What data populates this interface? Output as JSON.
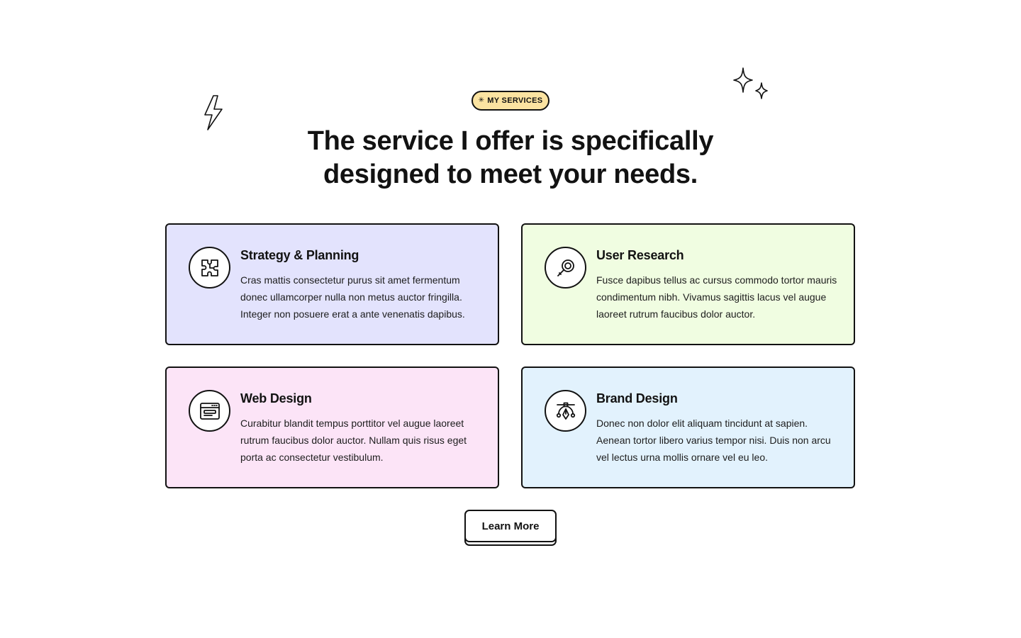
{
  "badge": {
    "icon": "asterisk-icon",
    "label": "MY SERVICES",
    "color": "#fbe3a1"
  },
  "heading": {
    "line1": "The service I offer is specifically",
    "line2": "designed to meet your needs."
  },
  "services": [
    {
      "icon": "puzzle-icon",
      "title": "Strategy & Planning",
      "description": "Cras mattis consectetur purus sit amet fermentum donec ullamcorper nulla non metus auctor fringilla. Integer non posuere erat a ante venenatis dapibus.",
      "color": "#e3e3fd"
    },
    {
      "icon": "magnifier-icon",
      "title": "User Research",
      "description": "Fusce dapibus tellus ac cursus commodo tortor mauris condimentum nibh. Vivamus sagittis lacus vel augue laoreet rutrum faucibus dolor auctor.",
      "color": "#f0fde1"
    },
    {
      "icon": "browser-window-icon",
      "title": "Web Design",
      "description": "Curabitur blandit tempus porttitor vel augue laoreet rutrum faucibus dolor auctor. Nullam quis risus eget porta ac consectetur vestibulum.",
      "color": "#fce4f7"
    },
    {
      "icon": "vector-pen-icon",
      "title": "Brand Design",
      "description": "Donec non dolor elit aliquam tincidunt at sapien. Aenean tortor libero varius tempor nisi. Duis non arcu vel lectus urna mollis ornare vel eu leo.",
      "color": "#e2f2fd"
    }
  ],
  "cta": {
    "label": "Learn More"
  },
  "decorations": [
    "lightning-bolt-icon",
    "sparkle-icon",
    "sparkle-icon"
  ]
}
